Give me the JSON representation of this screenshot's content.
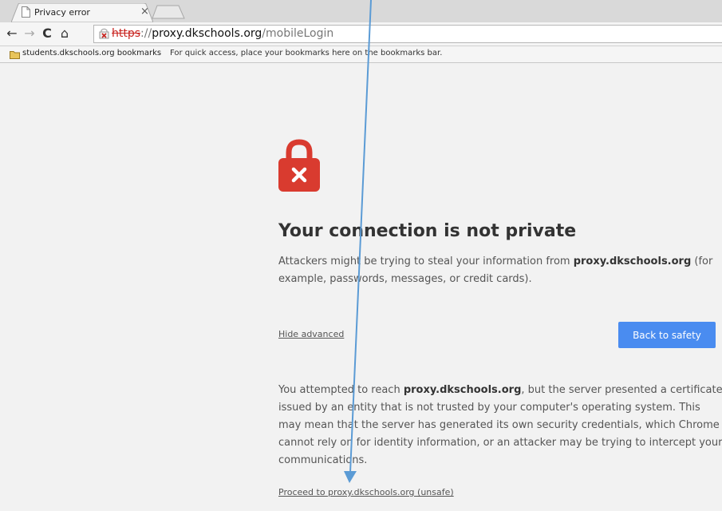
{
  "tabs": [
    {
      "title": "Privacy error",
      "close_glyph": "×"
    }
  ],
  "toolbar": {
    "back_glyph": "←",
    "forward_glyph": "→",
    "reload_glyph": "C",
    "home_glyph": "⌂"
  },
  "omnibox": {
    "scheme": "https",
    "separator": "://",
    "host": "proxy.dkschools.org",
    "path": "/mobileLogin",
    "security_icon": "not-secure-lock-icon"
  },
  "bookmarks_bar": {
    "folder_label": "students.dkschools.org bookmarks",
    "hint": "For quick access, place your bookmarks here on the bookmarks bar."
  },
  "interstitial": {
    "icon": "red-padlock-x-icon",
    "heading": "Your connection is not private",
    "lead_pre": "Attackers might be trying to steal your information from ",
    "lead_host": "proxy.dkschools.org",
    "lead_post": " (for example, passwords, messages, or credit cards).",
    "hide_advanced": "Hide advanced",
    "back_to_safety": "Back to safety",
    "details_pre": "You attempted to reach ",
    "details_host": "proxy.dkschools.org",
    "details_post": ", but the server presented a certificate issued by an entity that is not trusted by your computer's operating system. This may mean that the server has generated its own security credentials, which Chrome cannot rely on for identity information, or an attacker may be trying to intercept your communications.",
    "proceed_link": "Proceed to proxy.dkschools.org (unsafe)"
  },
  "colors": {
    "accent": "#4a8cf0",
    "danger": "#d93b2f",
    "annotation": "#5b9bd5"
  }
}
